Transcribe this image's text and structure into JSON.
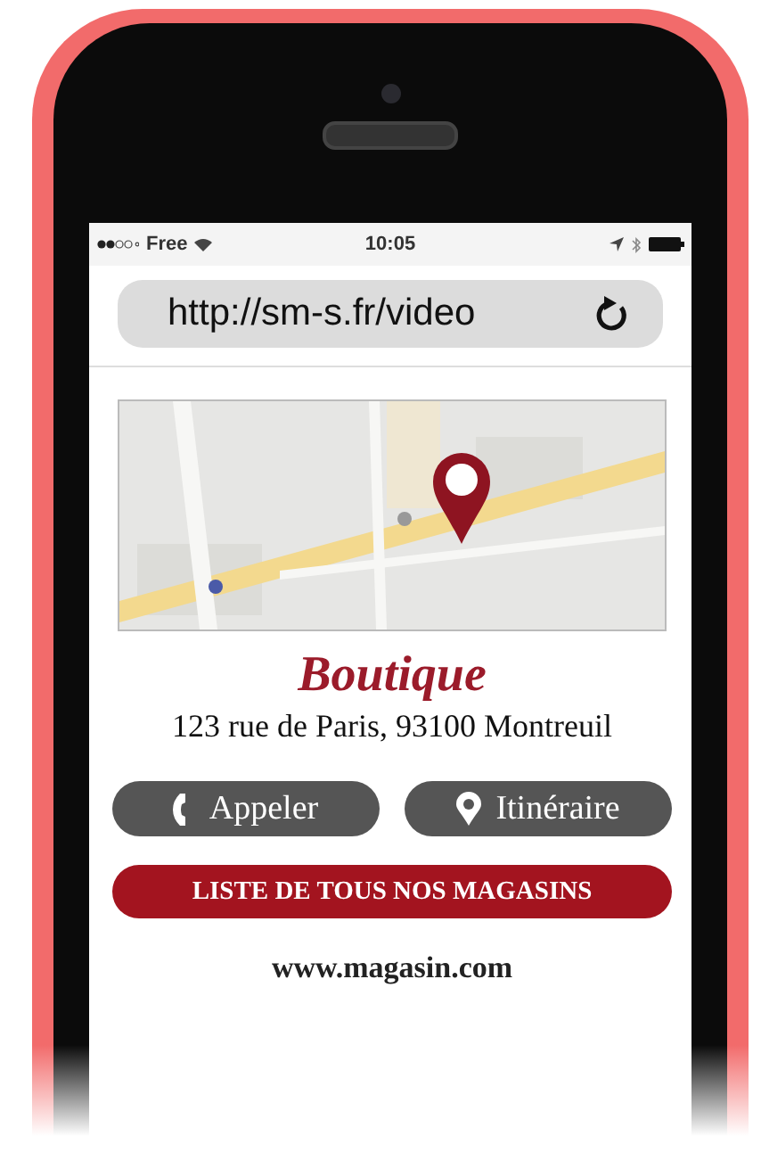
{
  "status_bar": {
    "carrier": "Free",
    "time": "10:05"
  },
  "address_bar": {
    "url": "http://sm-s.fr/video"
  },
  "store": {
    "title": "Boutique",
    "address": "123 rue de Paris, 93100 Montreuil"
  },
  "actions": [
    {
      "kind": "call",
      "label": "Appeler"
    },
    {
      "kind": "directions",
      "label": "Itinéraire"
    }
  ],
  "primary_button": {
    "label": "LISTE DE TOUS NOS MAGASINS"
  },
  "website": "www.magasin.com"
}
